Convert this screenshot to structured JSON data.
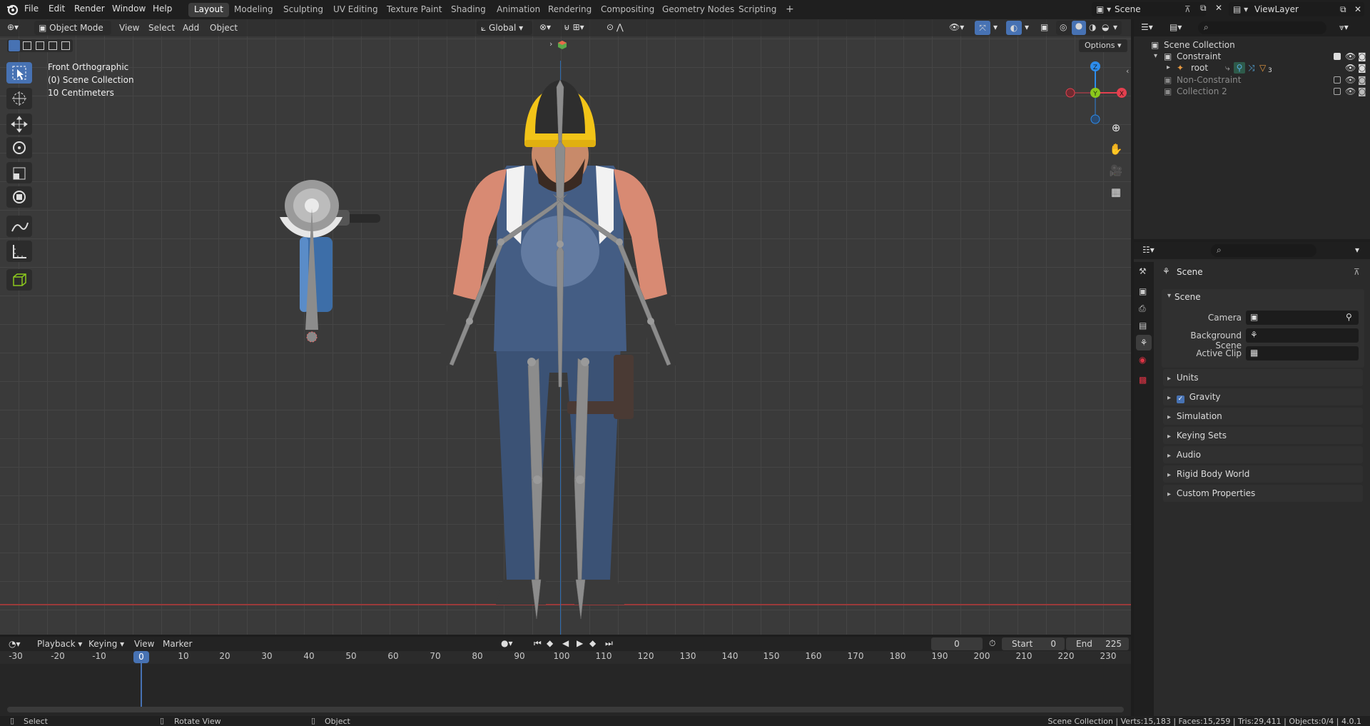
{
  "menu": [
    "File",
    "Edit",
    "Render",
    "Window",
    "Help"
  ],
  "workspaces": [
    "Layout",
    "Modeling",
    "Sculpting",
    "UV Editing",
    "Texture Paint",
    "Shading",
    "Animation",
    "Rendering",
    "Compositing",
    "Geometry Nodes",
    "Scripting"
  ],
  "active_workspace": "Layout",
  "scene_name": "Scene",
  "view_layer": "ViewLayer",
  "viewport": {
    "mode": "Object Mode",
    "menus": [
      "View",
      "Select",
      "Add",
      "Object"
    ],
    "orientation": "Global",
    "options": "Options",
    "view_name": "Front Orthographic",
    "collection_info": "(0) Scene Collection",
    "scale_info": "10 Centimeters",
    "gizmo_axes": {
      "z": "Z",
      "y": "Y",
      "x": "X"
    }
  },
  "outliner": {
    "root": "Scene Collection",
    "items": [
      {
        "label": "Constraint",
        "level": 1
      },
      {
        "label": "root",
        "level": 2
      },
      {
        "label": "Non-Constraint",
        "level": 1
      },
      {
        "label": "Collection 2",
        "level": 1
      }
    ],
    "root_badge": "3"
  },
  "properties": {
    "header": "Scene",
    "section": "Scene",
    "fields": [
      {
        "label": "Camera"
      },
      {
        "label": "Background Scene"
      },
      {
        "label": "Active Clip"
      }
    ],
    "panels": [
      "Units",
      "Gravity",
      "Simulation",
      "Keying Sets",
      "Audio",
      "Rigid Body World",
      "Custom Properties"
    ]
  },
  "timeline": {
    "menus": [
      "Playback",
      "Keying",
      "View",
      "Marker"
    ],
    "current_frame": "0",
    "start_label": "Start",
    "start": "0",
    "end_label": "End",
    "end": "225",
    "ruler": [
      "-30",
      "-20",
      "-10",
      "0",
      "10",
      "20",
      "30",
      "40",
      "50",
      "60",
      "70",
      "80",
      "90",
      "100",
      "110",
      "120",
      "130",
      "140",
      "150",
      "160",
      "170",
      "180",
      "190",
      "200",
      "210",
      "220",
      "230"
    ],
    "ruler_active": "0"
  },
  "status": {
    "select": "Select",
    "rotate": "Rotate View",
    "object": "Object",
    "stats": "Scene Collection | Verts:15,183 | Faces:15,259 | Tris:29,411 | Objects:0/4 | 4.0.1"
  },
  "colors": {
    "accent": "#4772b3",
    "x_axis": "#e4404f",
    "y_axis": "#8bc81c",
    "z_axis": "#2d8ceb",
    "bone": "#8c8c8c"
  }
}
